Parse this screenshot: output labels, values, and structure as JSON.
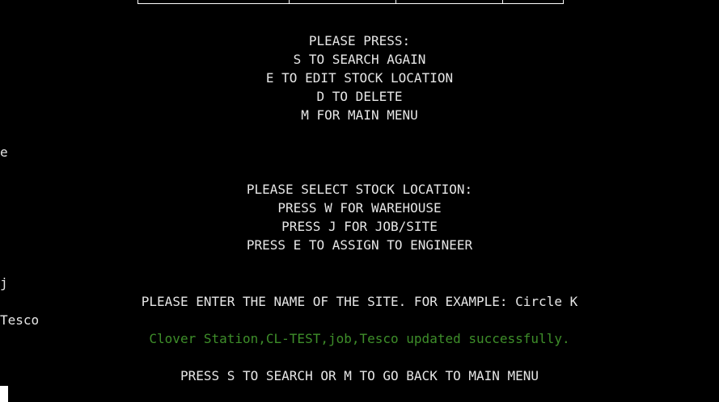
{
  "menu": {
    "title": "PLEASE PRESS:",
    "options": [
      "S TO SEARCH AGAIN",
      "E TO EDIT STOCK LOCATION",
      "D TO DELETE",
      "M FOR MAIN MENU"
    ]
  },
  "user_input_1": "e",
  "location_prompt": {
    "title": "PLEASE SELECT STOCK LOCATION:",
    "options": [
      "PRESS W FOR WAREHOUSE",
      "PRESS J FOR JOB/SITE",
      "PRESS E TO ASSIGN TO ENGINEER"
    ]
  },
  "user_input_2": "j",
  "site_prompt": "PLEASE ENTER THE NAME OF THE SITE. FOR EXAMPLE: Circle K",
  "user_input_3": "Tesco",
  "success_message": "Clover Station,CL-TEST,job,Tesco updated successfully.",
  "final_prompt": "PRESS S TO SEARCH OR M TO GO BACK TO MAIN MENU",
  "colors": {
    "background": "#000000",
    "text": "#e6e6e6",
    "success": "#3e8e2a"
  }
}
